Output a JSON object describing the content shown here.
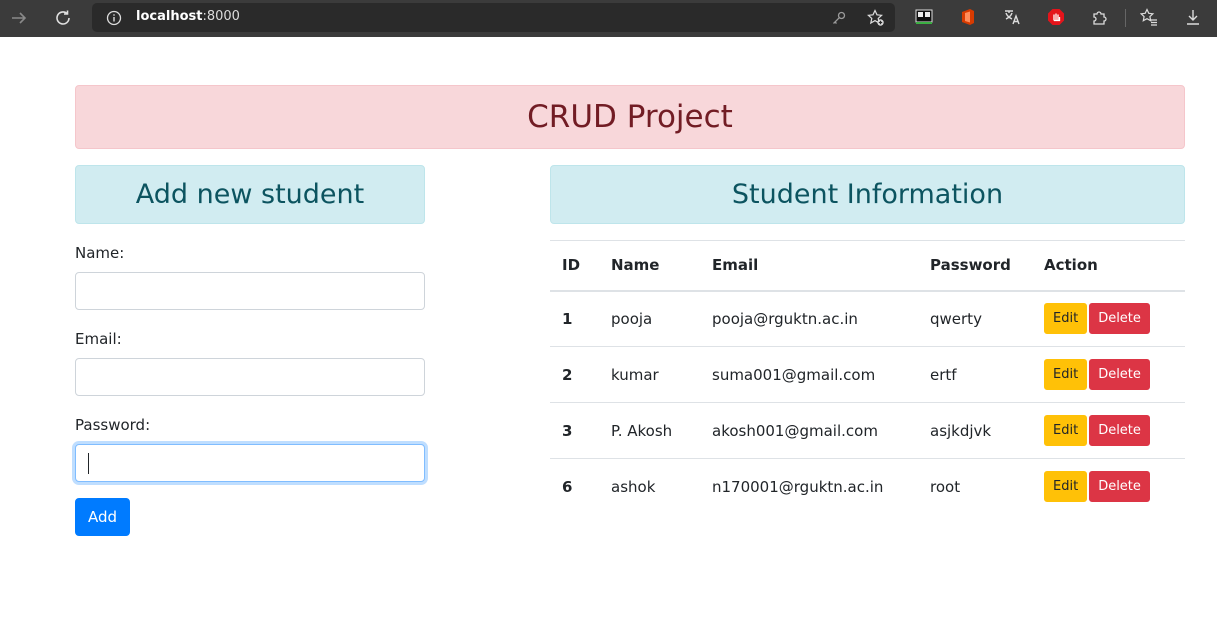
{
  "browser": {
    "url_host": "localhost",
    "url_port": ":8000"
  },
  "page": {
    "title": "CRUD Project",
    "form": {
      "heading": "Add new student",
      "name_label": "Name:",
      "email_label": "Email:",
      "password_label": "Password:",
      "name_value": "",
      "email_value": "",
      "password_value": "",
      "add_label": "Add"
    },
    "table": {
      "heading": "Student Information",
      "columns": [
        "ID",
        "Name",
        "Email",
        "Password",
        "Action"
      ],
      "rows": [
        {
          "id": "1",
          "name": "pooja",
          "email": "pooja@rguktn.ac.in",
          "password": "qwerty"
        },
        {
          "id": "2",
          "name": "kumar",
          "email": "suma001@gmail.com",
          "password": "ertf"
        },
        {
          "id": "3",
          "name": "P. Akosh",
          "email": "akosh001@gmail.com",
          "password": "asjkdjvk"
        },
        {
          "id": "6",
          "name": "ashok",
          "email": "n170001@rguktn.ac.in",
          "password": "root"
        }
      ],
      "edit_label": "Edit",
      "delete_label": "Delete"
    }
  },
  "colors": {
    "toolbar": "#3b3b3b",
    "danger_alert_bg": "#f8d7da",
    "info_alert_bg": "#d1ecf1",
    "primary": "#007bff",
    "warning": "#ffc107",
    "danger": "#dc3545"
  }
}
